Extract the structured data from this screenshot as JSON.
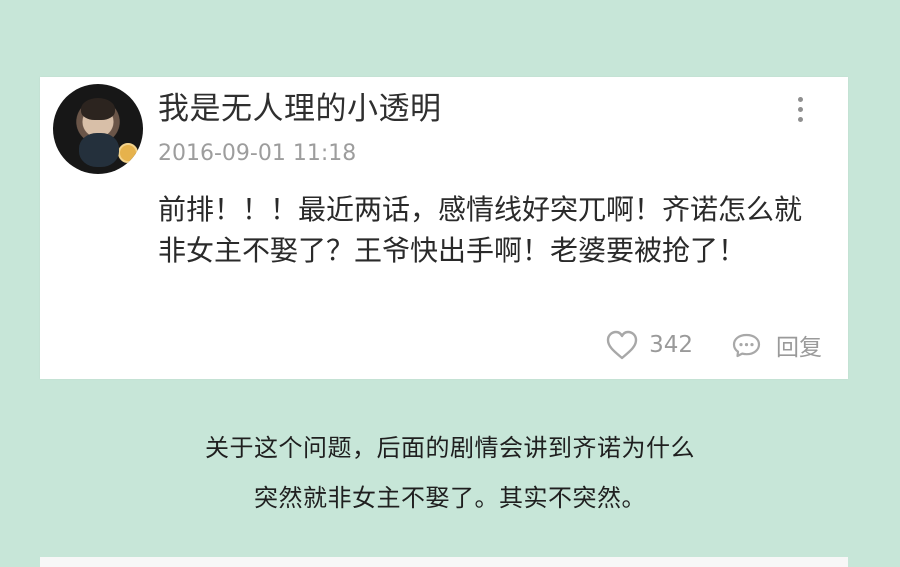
{
  "post": {
    "username": "我是无人理的小透明",
    "timestamp": "2016-09-01 11:18",
    "comment": "前排！！！最近两话，感情线好突兀啊！齐诺怎么就非女主不娶了？王爷快出手啊！老婆要被抢了！",
    "likes": "342",
    "reply_label": "回复",
    "icons": {
      "avatar": "avatar",
      "more": "more-vertical-icon",
      "like": "heart-icon",
      "reply": "comment-bubble-icon"
    }
  },
  "caption": {
    "line1": "关于这个问题，后面的剧情会讲到齐诺为什么",
    "line2": "突然就非女主不娶了。其实不突然。"
  },
  "colors": {
    "background": "#c7e6d8",
    "card": "#ffffff",
    "muted_text": "#9d9d9d",
    "main_text": "#2a2a2a"
  }
}
